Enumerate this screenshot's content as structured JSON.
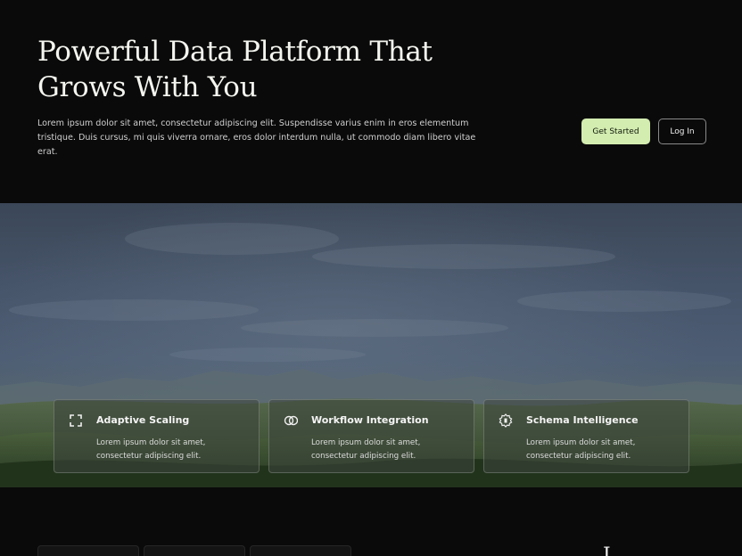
{
  "hero": {
    "title": "Powerful Data Platform That Grows With You",
    "description": "Lorem ipsum dolor sit amet, consectetur adipiscing elit. Suspendisse varius enim in eros elementum tristique. Duis cursus, mi quis viverra ornare, eros dolor interdum nulla, ut commodo diam libero vitae erat.",
    "primary_button": "Get Started",
    "secondary_button": "Log In"
  },
  "features": [
    {
      "icon": "expand-icon",
      "title": "Adaptive Scaling",
      "description": "Lorem ipsum dolor sit amet, consectetur adipiscing elit."
    },
    {
      "icon": "workflow-icon",
      "title": "Workflow Integration",
      "description": "Lorem ipsum dolor sit amet, consectetur adipiscing elit."
    },
    {
      "icon": "gear-icon",
      "title": "Schema Intelligence",
      "description": "Lorem ipsum dolor sit amet, consectetur adipiscing elit."
    }
  ],
  "lower": {
    "partial_heading": "I"
  },
  "colors": {
    "background": "#0a0a0a",
    "accent": "#d3ecb0"
  }
}
